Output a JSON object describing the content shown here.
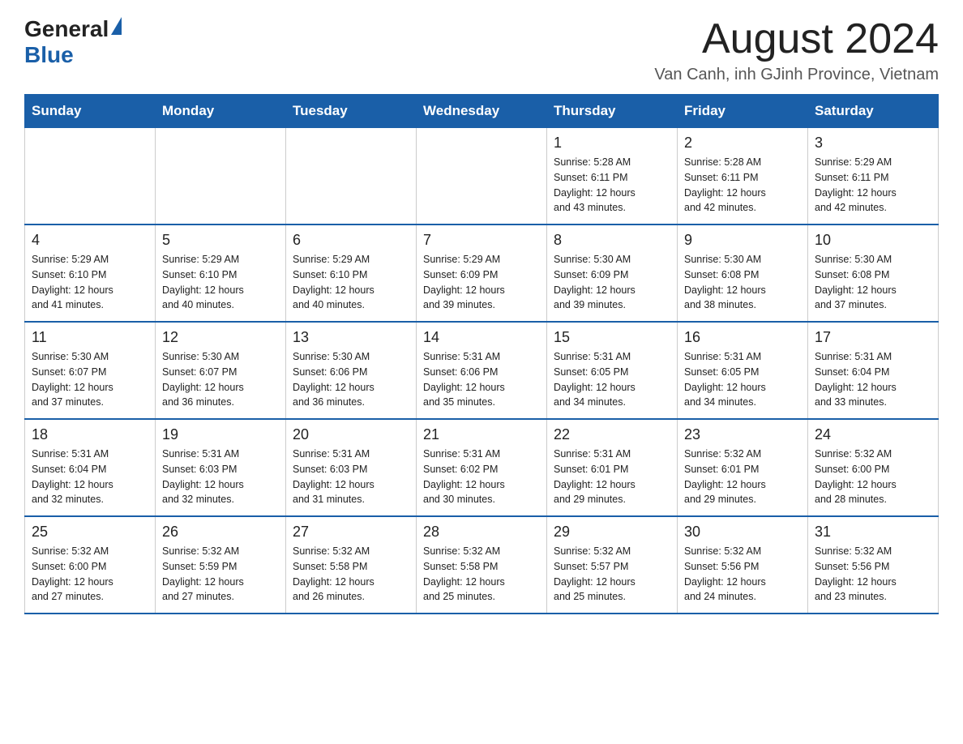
{
  "header": {
    "logo": {
      "general": "General",
      "blue": "Blue"
    },
    "month_title": "August 2024",
    "subtitle": "Van Canh, inh GJinh Province, Vietnam"
  },
  "weekdays": [
    "Sunday",
    "Monday",
    "Tuesday",
    "Wednesday",
    "Thursday",
    "Friday",
    "Saturday"
  ],
  "weeks": [
    [
      {
        "day": "",
        "info": ""
      },
      {
        "day": "",
        "info": ""
      },
      {
        "day": "",
        "info": ""
      },
      {
        "day": "",
        "info": ""
      },
      {
        "day": "1",
        "info": "Sunrise: 5:28 AM\nSunset: 6:11 PM\nDaylight: 12 hours\nand 43 minutes."
      },
      {
        "day": "2",
        "info": "Sunrise: 5:28 AM\nSunset: 6:11 PM\nDaylight: 12 hours\nand 42 minutes."
      },
      {
        "day": "3",
        "info": "Sunrise: 5:29 AM\nSunset: 6:11 PM\nDaylight: 12 hours\nand 42 minutes."
      }
    ],
    [
      {
        "day": "4",
        "info": "Sunrise: 5:29 AM\nSunset: 6:10 PM\nDaylight: 12 hours\nand 41 minutes."
      },
      {
        "day": "5",
        "info": "Sunrise: 5:29 AM\nSunset: 6:10 PM\nDaylight: 12 hours\nand 40 minutes."
      },
      {
        "day": "6",
        "info": "Sunrise: 5:29 AM\nSunset: 6:10 PM\nDaylight: 12 hours\nand 40 minutes."
      },
      {
        "day": "7",
        "info": "Sunrise: 5:29 AM\nSunset: 6:09 PM\nDaylight: 12 hours\nand 39 minutes."
      },
      {
        "day": "8",
        "info": "Sunrise: 5:30 AM\nSunset: 6:09 PM\nDaylight: 12 hours\nand 39 minutes."
      },
      {
        "day": "9",
        "info": "Sunrise: 5:30 AM\nSunset: 6:08 PM\nDaylight: 12 hours\nand 38 minutes."
      },
      {
        "day": "10",
        "info": "Sunrise: 5:30 AM\nSunset: 6:08 PM\nDaylight: 12 hours\nand 37 minutes."
      }
    ],
    [
      {
        "day": "11",
        "info": "Sunrise: 5:30 AM\nSunset: 6:07 PM\nDaylight: 12 hours\nand 37 minutes."
      },
      {
        "day": "12",
        "info": "Sunrise: 5:30 AM\nSunset: 6:07 PM\nDaylight: 12 hours\nand 36 minutes."
      },
      {
        "day": "13",
        "info": "Sunrise: 5:30 AM\nSunset: 6:06 PM\nDaylight: 12 hours\nand 36 minutes."
      },
      {
        "day": "14",
        "info": "Sunrise: 5:31 AM\nSunset: 6:06 PM\nDaylight: 12 hours\nand 35 minutes."
      },
      {
        "day": "15",
        "info": "Sunrise: 5:31 AM\nSunset: 6:05 PM\nDaylight: 12 hours\nand 34 minutes."
      },
      {
        "day": "16",
        "info": "Sunrise: 5:31 AM\nSunset: 6:05 PM\nDaylight: 12 hours\nand 34 minutes."
      },
      {
        "day": "17",
        "info": "Sunrise: 5:31 AM\nSunset: 6:04 PM\nDaylight: 12 hours\nand 33 minutes."
      }
    ],
    [
      {
        "day": "18",
        "info": "Sunrise: 5:31 AM\nSunset: 6:04 PM\nDaylight: 12 hours\nand 32 minutes."
      },
      {
        "day": "19",
        "info": "Sunrise: 5:31 AM\nSunset: 6:03 PM\nDaylight: 12 hours\nand 32 minutes."
      },
      {
        "day": "20",
        "info": "Sunrise: 5:31 AM\nSunset: 6:03 PM\nDaylight: 12 hours\nand 31 minutes."
      },
      {
        "day": "21",
        "info": "Sunrise: 5:31 AM\nSunset: 6:02 PM\nDaylight: 12 hours\nand 30 minutes."
      },
      {
        "day": "22",
        "info": "Sunrise: 5:31 AM\nSunset: 6:01 PM\nDaylight: 12 hours\nand 29 minutes."
      },
      {
        "day": "23",
        "info": "Sunrise: 5:32 AM\nSunset: 6:01 PM\nDaylight: 12 hours\nand 29 minutes."
      },
      {
        "day": "24",
        "info": "Sunrise: 5:32 AM\nSunset: 6:00 PM\nDaylight: 12 hours\nand 28 minutes."
      }
    ],
    [
      {
        "day": "25",
        "info": "Sunrise: 5:32 AM\nSunset: 6:00 PM\nDaylight: 12 hours\nand 27 minutes."
      },
      {
        "day": "26",
        "info": "Sunrise: 5:32 AM\nSunset: 5:59 PM\nDaylight: 12 hours\nand 27 minutes."
      },
      {
        "day": "27",
        "info": "Sunrise: 5:32 AM\nSunset: 5:58 PM\nDaylight: 12 hours\nand 26 minutes."
      },
      {
        "day": "28",
        "info": "Sunrise: 5:32 AM\nSunset: 5:58 PM\nDaylight: 12 hours\nand 25 minutes."
      },
      {
        "day": "29",
        "info": "Sunrise: 5:32 AM\nSunset: 5:57 PM\nDaylight: 12 hours\nand 25 minutes."
      },
      {
        "day": "30",
        "info": "Sunrise: 5:32 AM\nSunset: 5:56 PM\nDaylight: 12 hours\nand 24 minutes."
      },
      {
        "day": "31",
        "info": "Sunrise: 5:32 AM\nSunset: 5:56 PM\nDaylight: 12 hours\nand 23 minutes."
      }
    ]
  ]
}
